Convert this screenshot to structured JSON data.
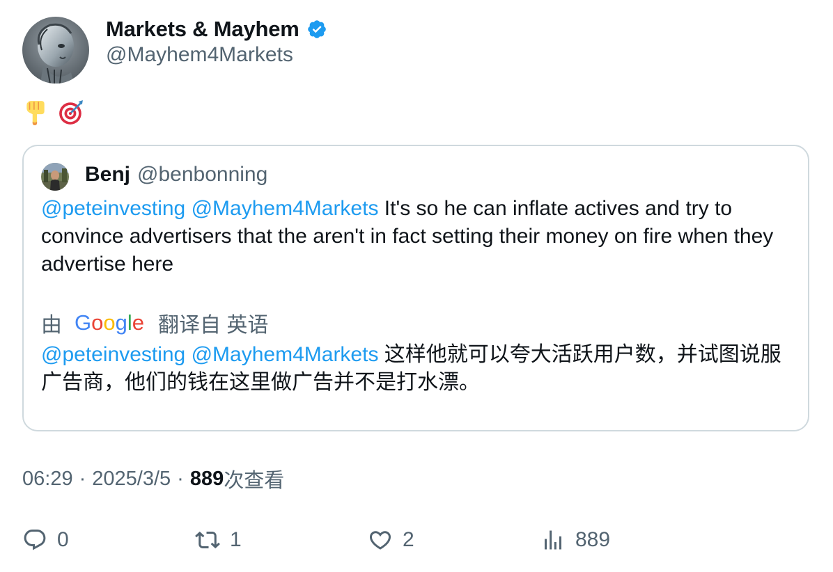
{
  "author": {
    "name": "Markets & Mayhem",
    "handle": "@Mayhem4Markets",
    "verified_color": "#1d9bf0"
  },
  "tweet": {
    "emojis": [
      "backhand-index-pointing-down",
      "direct-hit"
    ]
  },
  "quote": {
    "name": "Benj",
    "handle": "@benbonning",
    "mention_1": "@peteinvesting",
    "mention_2": "@Mayhem4Markets",
    "body_text": "It's so he can inflate actives and try to convince advertisers that the aren't in fact setting their money on fire when they advertise here",
    "translate_by": "由",
    "translate_brand": "Google",
    "translate_from": "翻译自 英语",
    "translated_text": "这样他就可以夸大活跃用户数，并试图说服广告商，他们的钱在这里做广告并不是打水漂。"
  },
  "meta": {
    "time": "06:29",
    "separator": "·",
    "date": "2025/3/5",
    "views_count": "889",
    "views_label": "次查看"
  },
  "actions": {
    "replies": "0",
    "reposts": "1",
    "likes": "2",
    "views": "889"
  },
  "colors": {
    "link": "#1d9bf0",
    "secondary_text": "#536471",
    "border": "#cfd9de"
  }
}
